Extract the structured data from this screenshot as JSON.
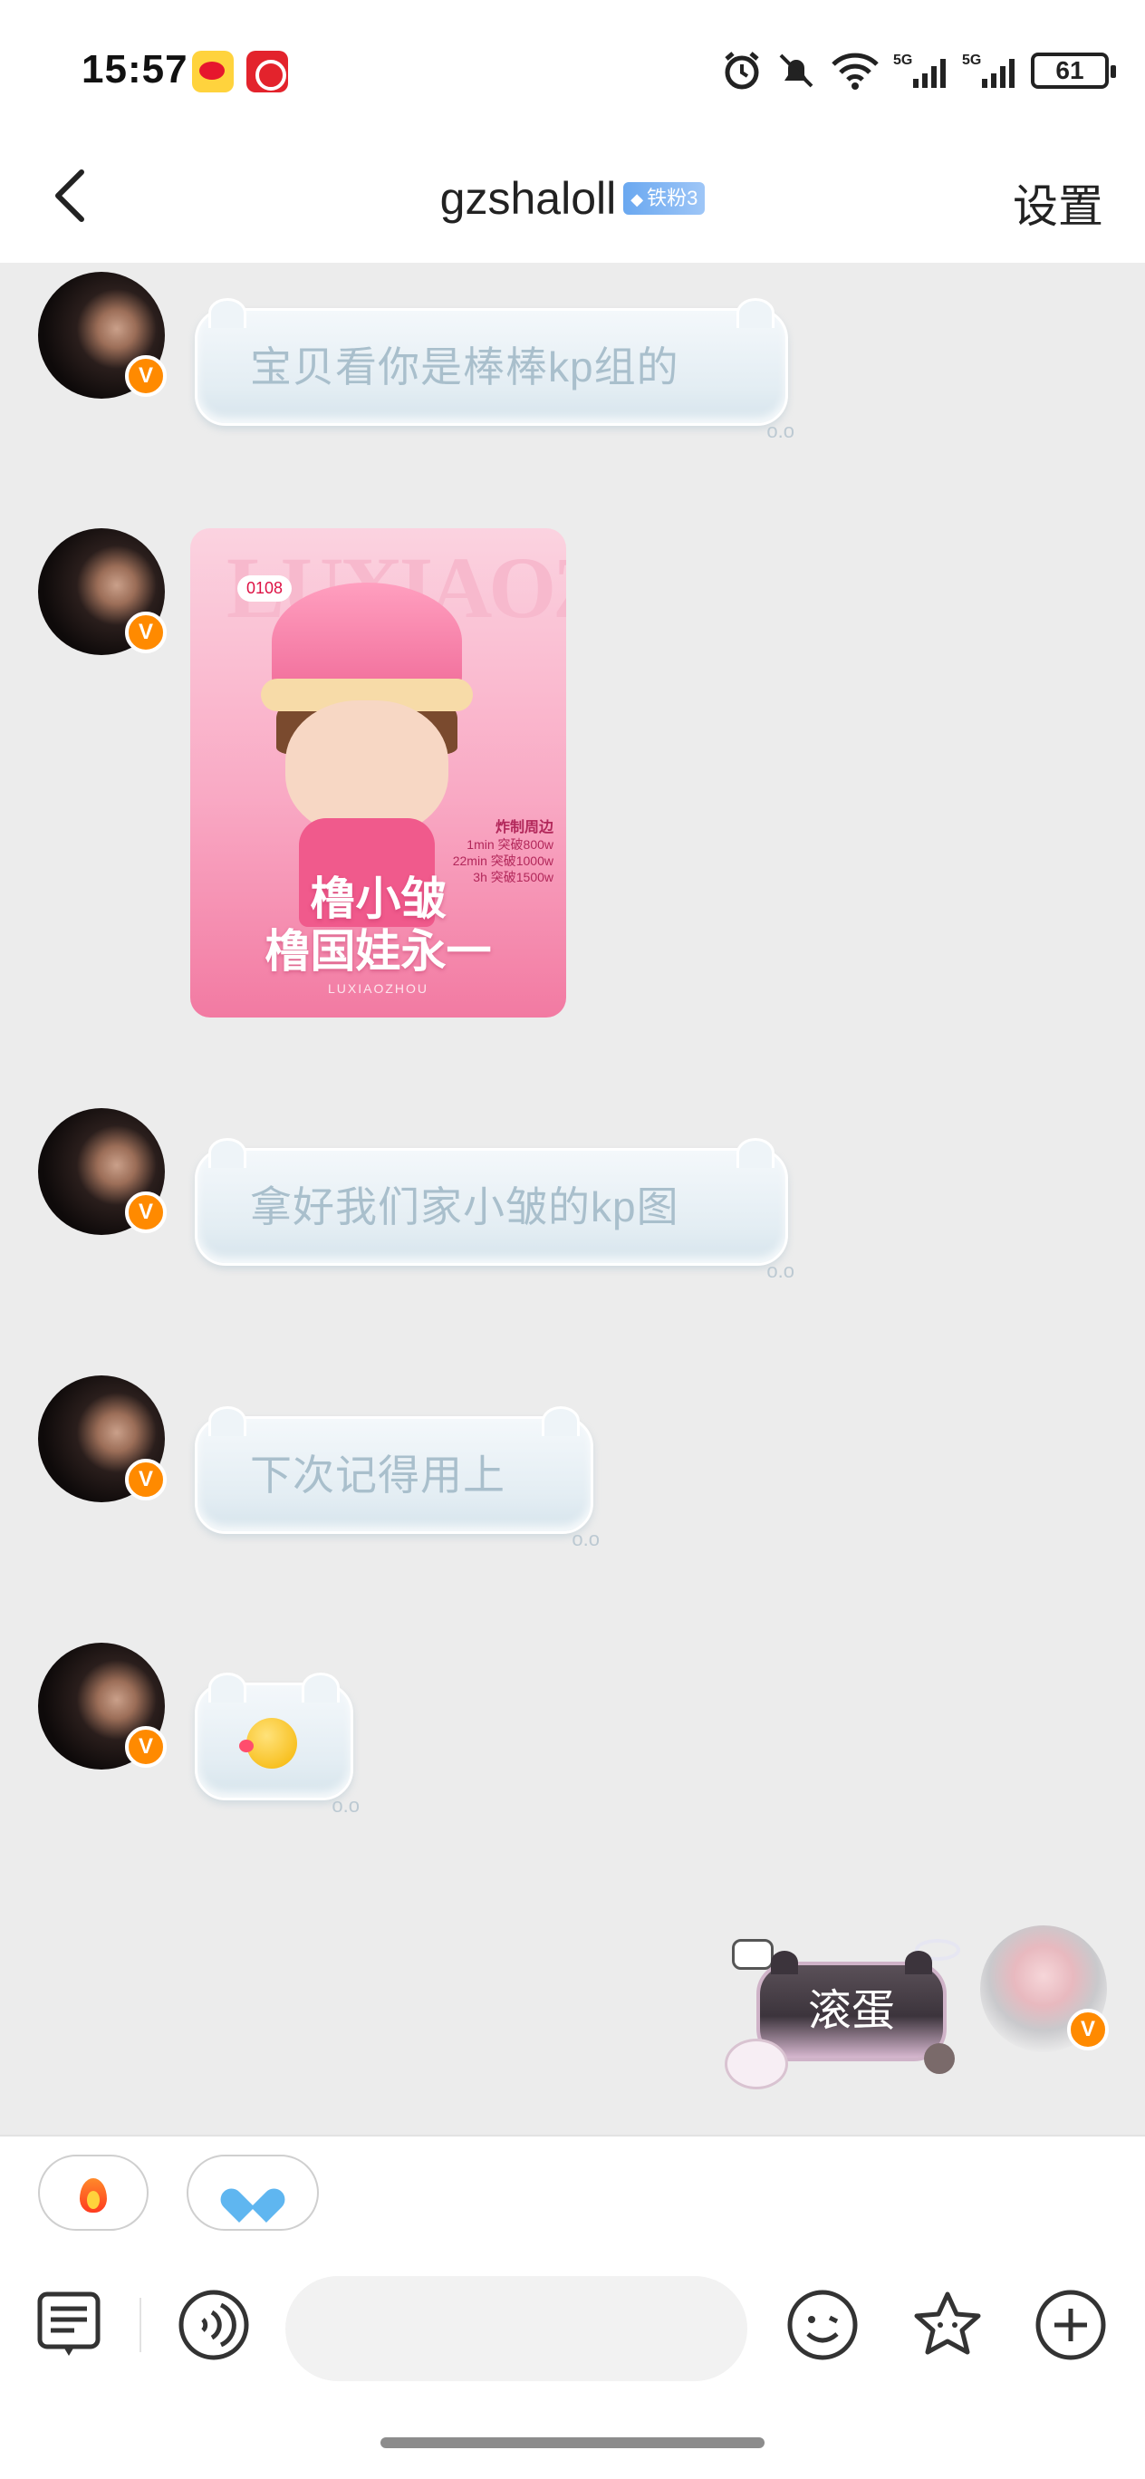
{
  "status_bar": {
    "time": "15:57",
    "battery": "61",
    "network_1": "5G",
    "network_2": "5G",
    "wifi_label": "6"
  },
  "header": {
    "username": "gzshaloll",
    "fan_badge": "铁粉3",
    "settings_label": "设置"
  },
  "messages": [
    {
      "from": "other",
      "type": "text",
      "text": "宝贝看你是棒棒kp组的"
    },
    {
      "from": "other",
      "type": "image",
      "card": {
        "tag": "0108",
        "big_text": "LUXIAOZHOU",
        "side_heading": "炸制周边",
        "side_lines": [
          "1min 突破800w",
          "22min 突破1000w",
          "3h 突破1500w"
        ],
        "caption_line1": "橹小皱",
        "caption_line2": "橹国娃永一",
        "sub": "LUXIAOZHOU"
      }
    },
    {
      "from": "other",
      "type": "text",
      "text": "拿好我们家小皱的kp图"
    },
    {
      "from": "other",
      "type": "text",
      "text": "下次记得用上"
    },
    {
      "from": "other",
      "type": "emoji",
      "emoji": "kissing-face"
    },
    {
      "from": "me",
      "type": "text",
      "text": "滚蛋"
    }
  ],
  "quick_replies": [
    {
      "icon": "flame-icon"
    },
    {
      "icon": "blue-heart-icon"
    }
  ],
  "composer": {
    "placeholder": ""
  },
  "colors": {
    "accent_badge": "#ff8a00",
    "fan_badge": "#6aa8f0",
    "bubble_text": "#a9bfcc"
  }
}
